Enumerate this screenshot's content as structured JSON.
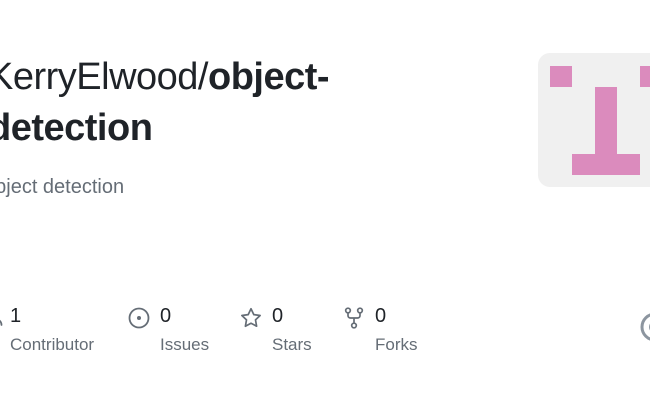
{
  "repo": {
    "owner": "KerryElwood/",
    "name_line1": "object-",
    "name_line2": "detection",
    "description": "object detection"
  },
  "stats": [
    {
      "count": "1",
      "label": "Contributor",
      "icon": "people-icon"
    },
    {
      "count": "0",
      "label": "Issues",
      "icon": "issue-opened-icon"
    },
    {
      "count": "0",
      "label": "Stars",
      "icon": "star-icon"
    },
    {
      "count": "0",
      "label": "Forks",
      "icon": "repo-forked-icon"
    }
  ],
  "colors": {
    "title": "#1f2328",
    "muted": "#656d76",
    "avatar_bg": "#f0f0f0",
    "avatar_fg": "#db8bbd"
  }
}
